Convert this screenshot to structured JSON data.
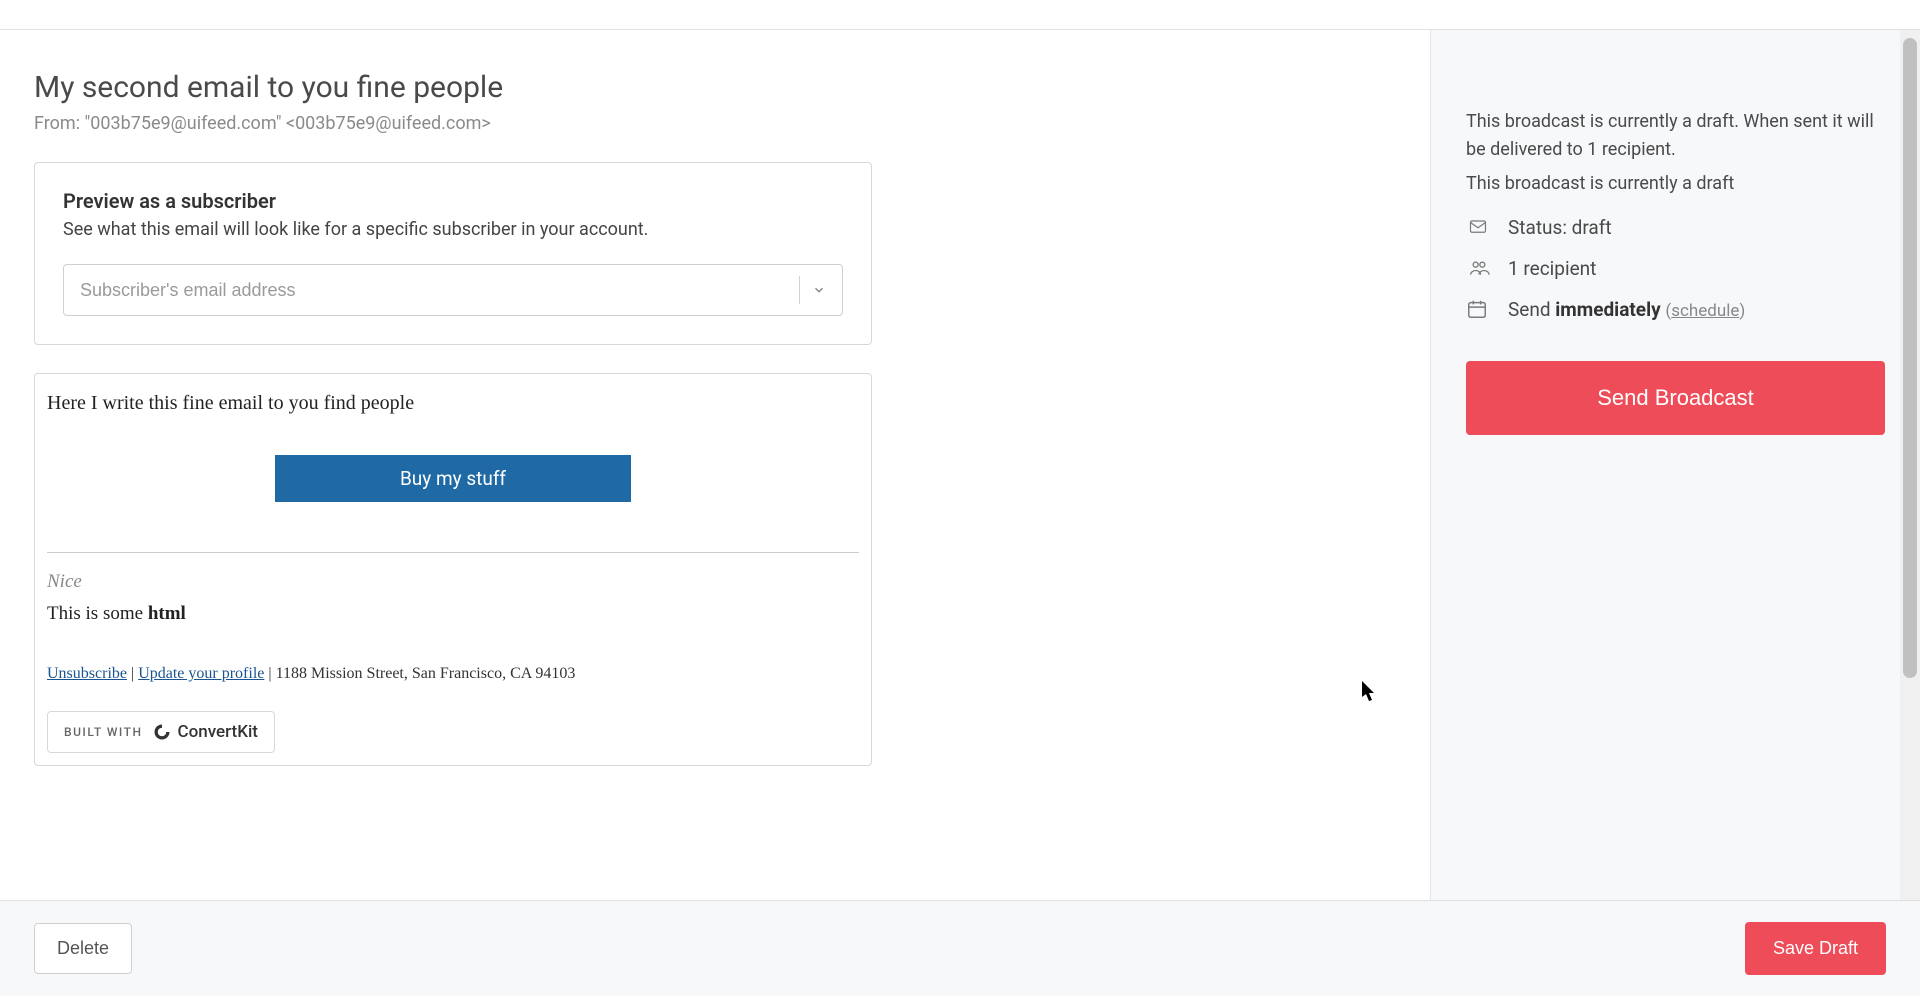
{
  "header": {
    "title": "My second email to you fine people",
    "from_label": "From: \"003b75e9@uifeed.com\" <003b75e9@uifeed.com>"
  },
  "preview": {
    "title": "Preview as a subscriber",
    "description": "See what this email will look like for a specific subscriber in your account.",
    "placeholder": "Subscriber's email address"
  },
  "email": {
    "body_line": "Here I write this fine email to you find people",
    "cta_label": "Buy my stuff",
    "footer_nice": "Nice",
    "footer_html_prefix": "This is some ",
    "footer_html_bold": "html",
    "unsubscribe": "Unsubscribe",
    "update_profile": "Update your profile",
    "address": "1188 Mission Street, San Francisco, CA 94103",
    "built_with": "BUILT WITH",
    "brand": "ConvertKit"
  },
  "sidebar": {
    "intro": "This broadcast is currently a draft. When sent it will be delivered to 1 recipient.",
    "intro2": "This broadcast is currently a draft",
    "status_label": "Status: draft",
    "recipients": "1 recipient",
    "send_prefix": "Send ",
    "send_bold": "immediately",
    "schedule_prefix": " (",
    "schedule_link": "schedule",
    "schedule_suffix": ")",
    "send_button": "Send Broadcast"
  },
  "footer": {
    "delete": "Delete",
    "save_draft": "Save Draft"
  }
}
